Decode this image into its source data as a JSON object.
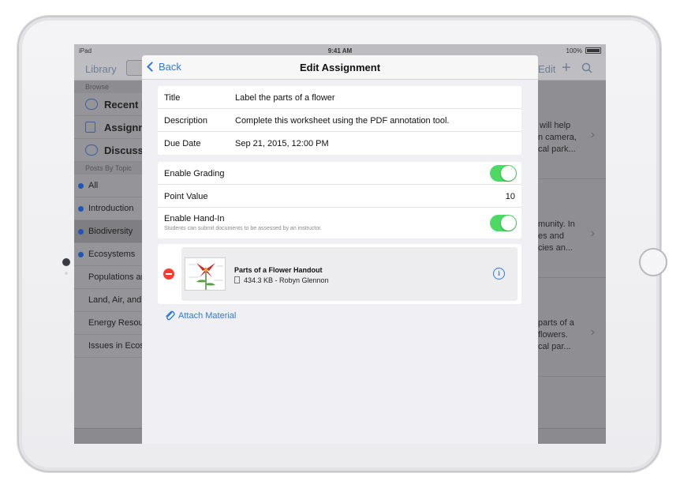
{
  "status_bar": {
    "carrier": "iPad",
    "time": "9:41 AM",
    "battery": "100%"
  },
  "background_app": {
    "nav": {
      "library": "Library",
      "edit": "Edit"
    },
    "sidebar": {
      "browse_header": "Browse",
      "browse_items": [
        "Recent P",
        "Assignme",
        "Discussio"
      ],
      "topics_header": "Posts By Topic",
      "topics": [
        {
          "label": "All",
          "dot": true,
          "selected": false
        },
        {
          "label": "Introduction",
          "dot": true,
          "selected": false
        },
        {
          "label": "Biodiversity",
          "dot": true,
          "selected": true
        },
        {
          "label": "Ecosystems",
          "dot": true,
          "selected": false
        },
        {
          "label": "Populations ar",
          "dot": false,
          "selected": false
        },
        {
          "label": "Land, Air, and",
          "dot": false,
          "selected": false
        },
        {
          "label": "Energy Resour",
          "dot": false,
          "selected": false
        },
        {
          "label": "Issues in Ecos",
          "dot": false,
          "selected": false
        }
      ]
    },
    "content_cells": [
      {
        "lines": [
          "will help",
          "n camera,",
          "cal park..."
        ]
      },
      {
        "lines": [
          "munity. In",
          "es and",
          "cies an..."
        ]
      },
      {
        "lines": [
          "parts of a",
          "flowers.",
          "cal par..."
        ]
      }
    ]
  },
  "modal": {
    "back_label": "Back",
    "title": "Edit Assignment",
    "details": {
      "title_label": "Title",
      "title_value": "Label the parts of a flower",
      "description_label": "Description",
      "description_value": "Complete this worksheet using the PDF annotation tool.",
      "due_label": "Due Date",
      "due_value": "Sep 21, 2015, 12:00 PM"
    },
    "grading": {
      "enable_grading_label": "Enable Grading",
      "enable_grading_on": true,
      "point_value_label": "Point Value",
      "point_value": "10",
      "enable_handin_label": "Enable Hand-In",
      "enable_handin_sub": "Students can submit documents to be assessed by an instructor.",
      "enable_handin_on": true
    },
    "attachment": {
      "name": "Parts of a Flower Handout",
      "meta": "434.3 KB - Robyn Glennon"
    },
    "attach_link": "Attach Material"
  },
  "colors": {
    "accent": "#2e7bd6",
    "toggle_on": "#4cd964",
    "delete": "#ff3b30",
    "topic_dot": "#1e56b8"
  }
}
